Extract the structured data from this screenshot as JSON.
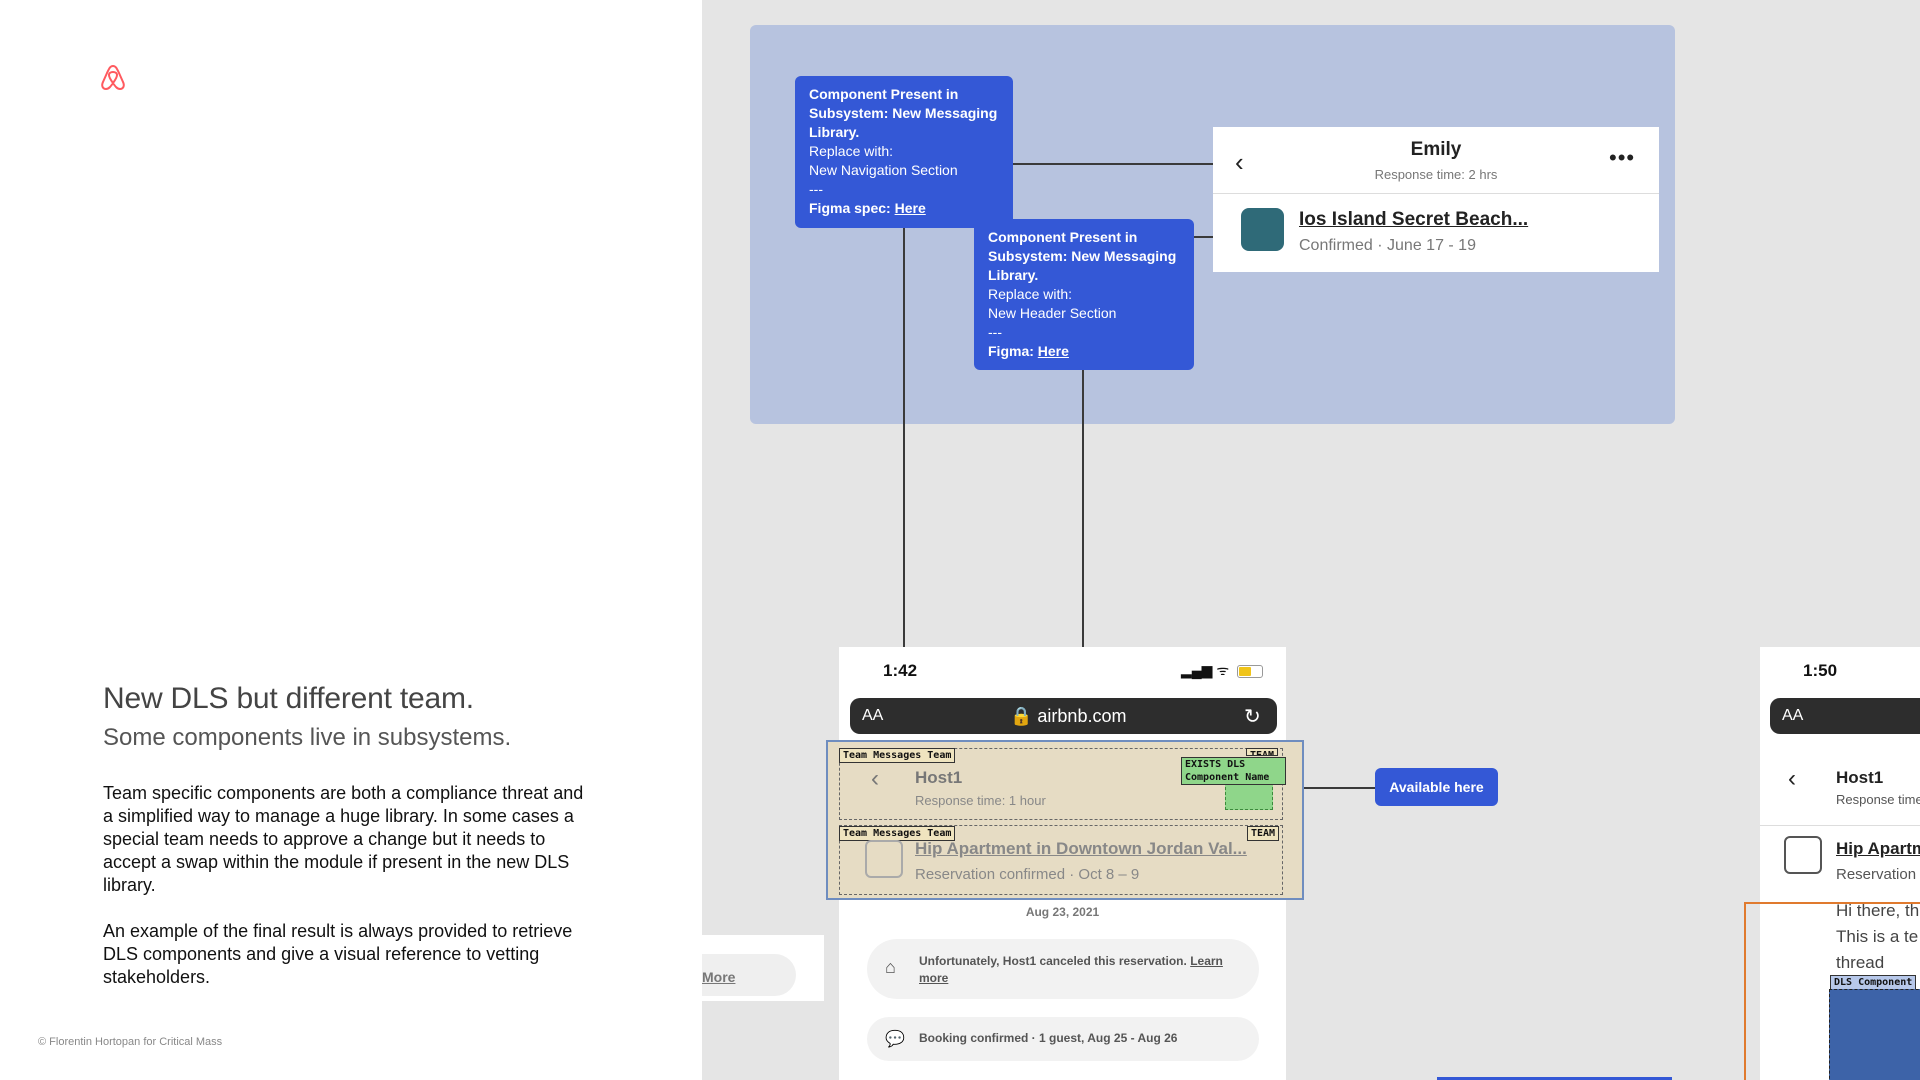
{
  "left_panel": {
    "heading": "New DLS but different team.",
    "subheading": "Some components live in subsystems.",
    "paragraph1": "Team specific components are both a compliance threat and a simplified way to manage a huge library. In some cases a special team needs to approve a change but it needs to accept a swap within the module if present in the new DLS library.",
    "paragraph2": "An example of the final result is always provided to retrieve DLS components and give a visual reference to vetting stakeholders.",
    "copyright": "© Florentin Hortopan for Critical Mass"
  },
  "note1": {
    "title": "Component Present in Subsystem: New Messaging Library.",
    "replace_label": "Replace with:",
    "replace_value": "New Navigation Section",
    "separator": "---",
    "spec_label": "Figma spec:",
    "link": "Here"
  },
  "note2": {
    "title": "Component Present in Subsystem: New Messaging Library.",
    "replace_label": "Replace with:",
    "replace_value": "New Header Section",
    "separator": "---",
    "spec_label": "Figma:",
    "link": "Here"
  },
  "emily_card": {
    "name": "Emily",
    "response": "Response time: 2 hrs",
    "listing": "Ios Island Secret Beach...",
    "status": "Confirmed · June 17 - 19",
    "back_icon": "‹",
    "more_icon": "•••"
  },
  "phone1": {
    "time": "1:42",
    "status_icons": "▂▄▆ ᯤ",
    "url_aa": "AA",
    "url": "🔒 airbnb.com",
    "reload_icon": "↻",
    "tag_team1": "Team Messages Team",
    "tag_team2": "Team Messages Team",
    "tag_corner1": "TEAM",
    "tag_corner2": "TEAM",
    "tag_dls": "EXISTS DLS Component Name",
    "host": "Host1",
    "host_response": "Response time: 1 hour",
    "back_icon": "‹",
    "listing": "Hip Apartment in Downtown Jordan Val...",
    "listing_status": "Reservation confirmed · Oct 8 – 9",
    "date": "Aug 23, 2021",
    "msg1_text": "Unfortunately, Host1 canceled this reservation.",
    "msg1_link": "Learn more",
    "msg2_text": "Booking confirmed · 1 guest, Aug 25 - Aug 26"
  },
  "available_button": "Available here",
  "more_link": "More",
  "phone2": {
    "time": "1:50",
    "url_aa": "AA",
    "back_icon": "‹",
    "host": "Host1",
    "host_response": "Response time",
    "listing": "Hip Apartm",
    "listing_status": "Reservation",
    "msg_line1": "Hi there, th",
    "msg_line2": "This is a te",
    "msg_line3": "thread",
    "tag_dls": "DLS Component"
  },
  "colors": {
    "brand": "#ff5a5f",
    "note_blue": "#3458d6",
    "frame": "#b7c3df",
    "highlight": "#e6dcc4",
    "green": "#8fd68a",
    "orange": "#e07a2e"
  }
}
